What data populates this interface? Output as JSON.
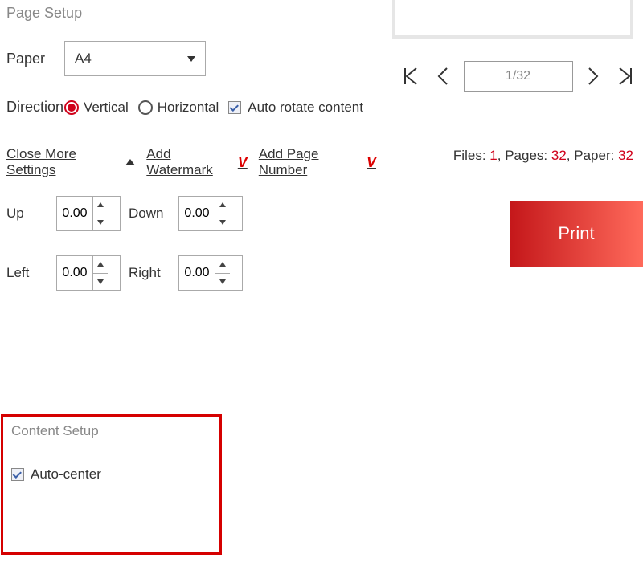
{
  "page_setup": {
    "title": "Page Setup",
    "paper_label": "Paper",
    "paper_value": "A4",
    "direction_label": "Direction",
    "vertical_label": "Vertical",
    "horizontal_label": "Horizontal",
    "auto_rotate_label": "Auto rotate content"
  },
  "links": {
    "close_more": "Close More Settings",
    "add_watermark": "Add Watermark",
    "add_page_number": "Add Page Number"
  },
  "margins": {
    "up_label": "Up",
    "up_value": "0.00",
    "down_label": "Down",
    "down_value": "0.00",
    "left_label": "Left",
    "left_value": "0.00",
    "right_label": "Right",
    "right_value": "0.00"
  },
  "content_setup": {
    "title": "Content Setup",
    "auto_center_label": "Auto-center"
  },
  "pager": {
    "indicator": "1/32"
  },
  "summary": {
    "files_label": "Files:",
    "files_value": "1",
    "pages_label": "Pages:",
    "pages_value": "32",
    "paper_label": "Paper:",
    "paper_value": "32"
  },
  "print_label": "Print"
}
